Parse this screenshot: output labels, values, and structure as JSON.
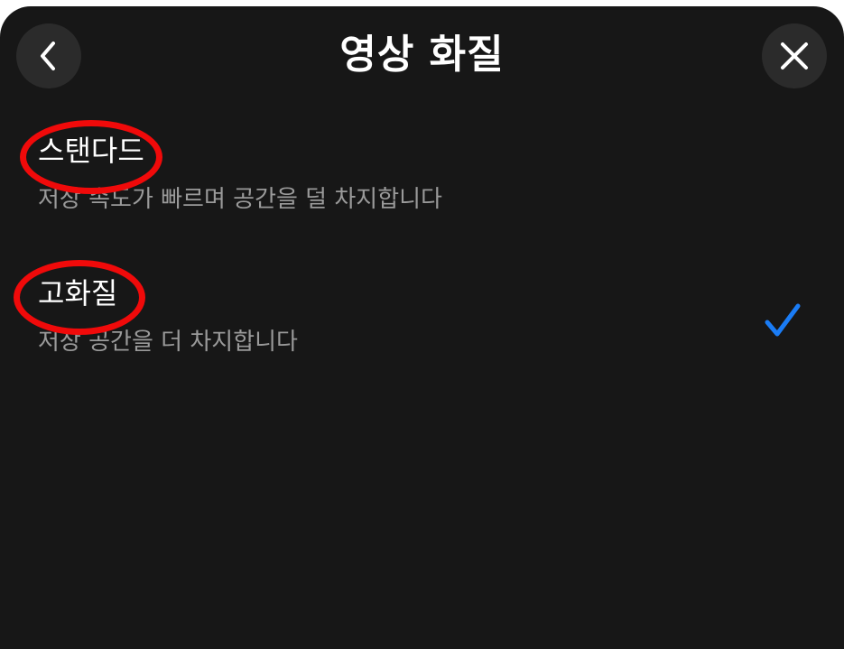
{
  "header": {
    "title": "영상 화질",
    "back_icon": "chevron-left-icon",
    "close_icon": "close-icon"
  },
  "options": [
    {
      "label": "스탠다드",
      "description": "저장 속도가 빠르며 공간을 덜 차지합니다",
      "selected": false
    },
    {
      "label": "고화질",
      "description": "저장 공간을 더 차지합니다",
      "selected": true
    }
  ],
  "colors": {
    "background": "#171717",
    "button_background": "#2b2b2b",
    "check_accent": "#1a7cf5",
    "annotation_circle": "#f00a0a"
  }
}
